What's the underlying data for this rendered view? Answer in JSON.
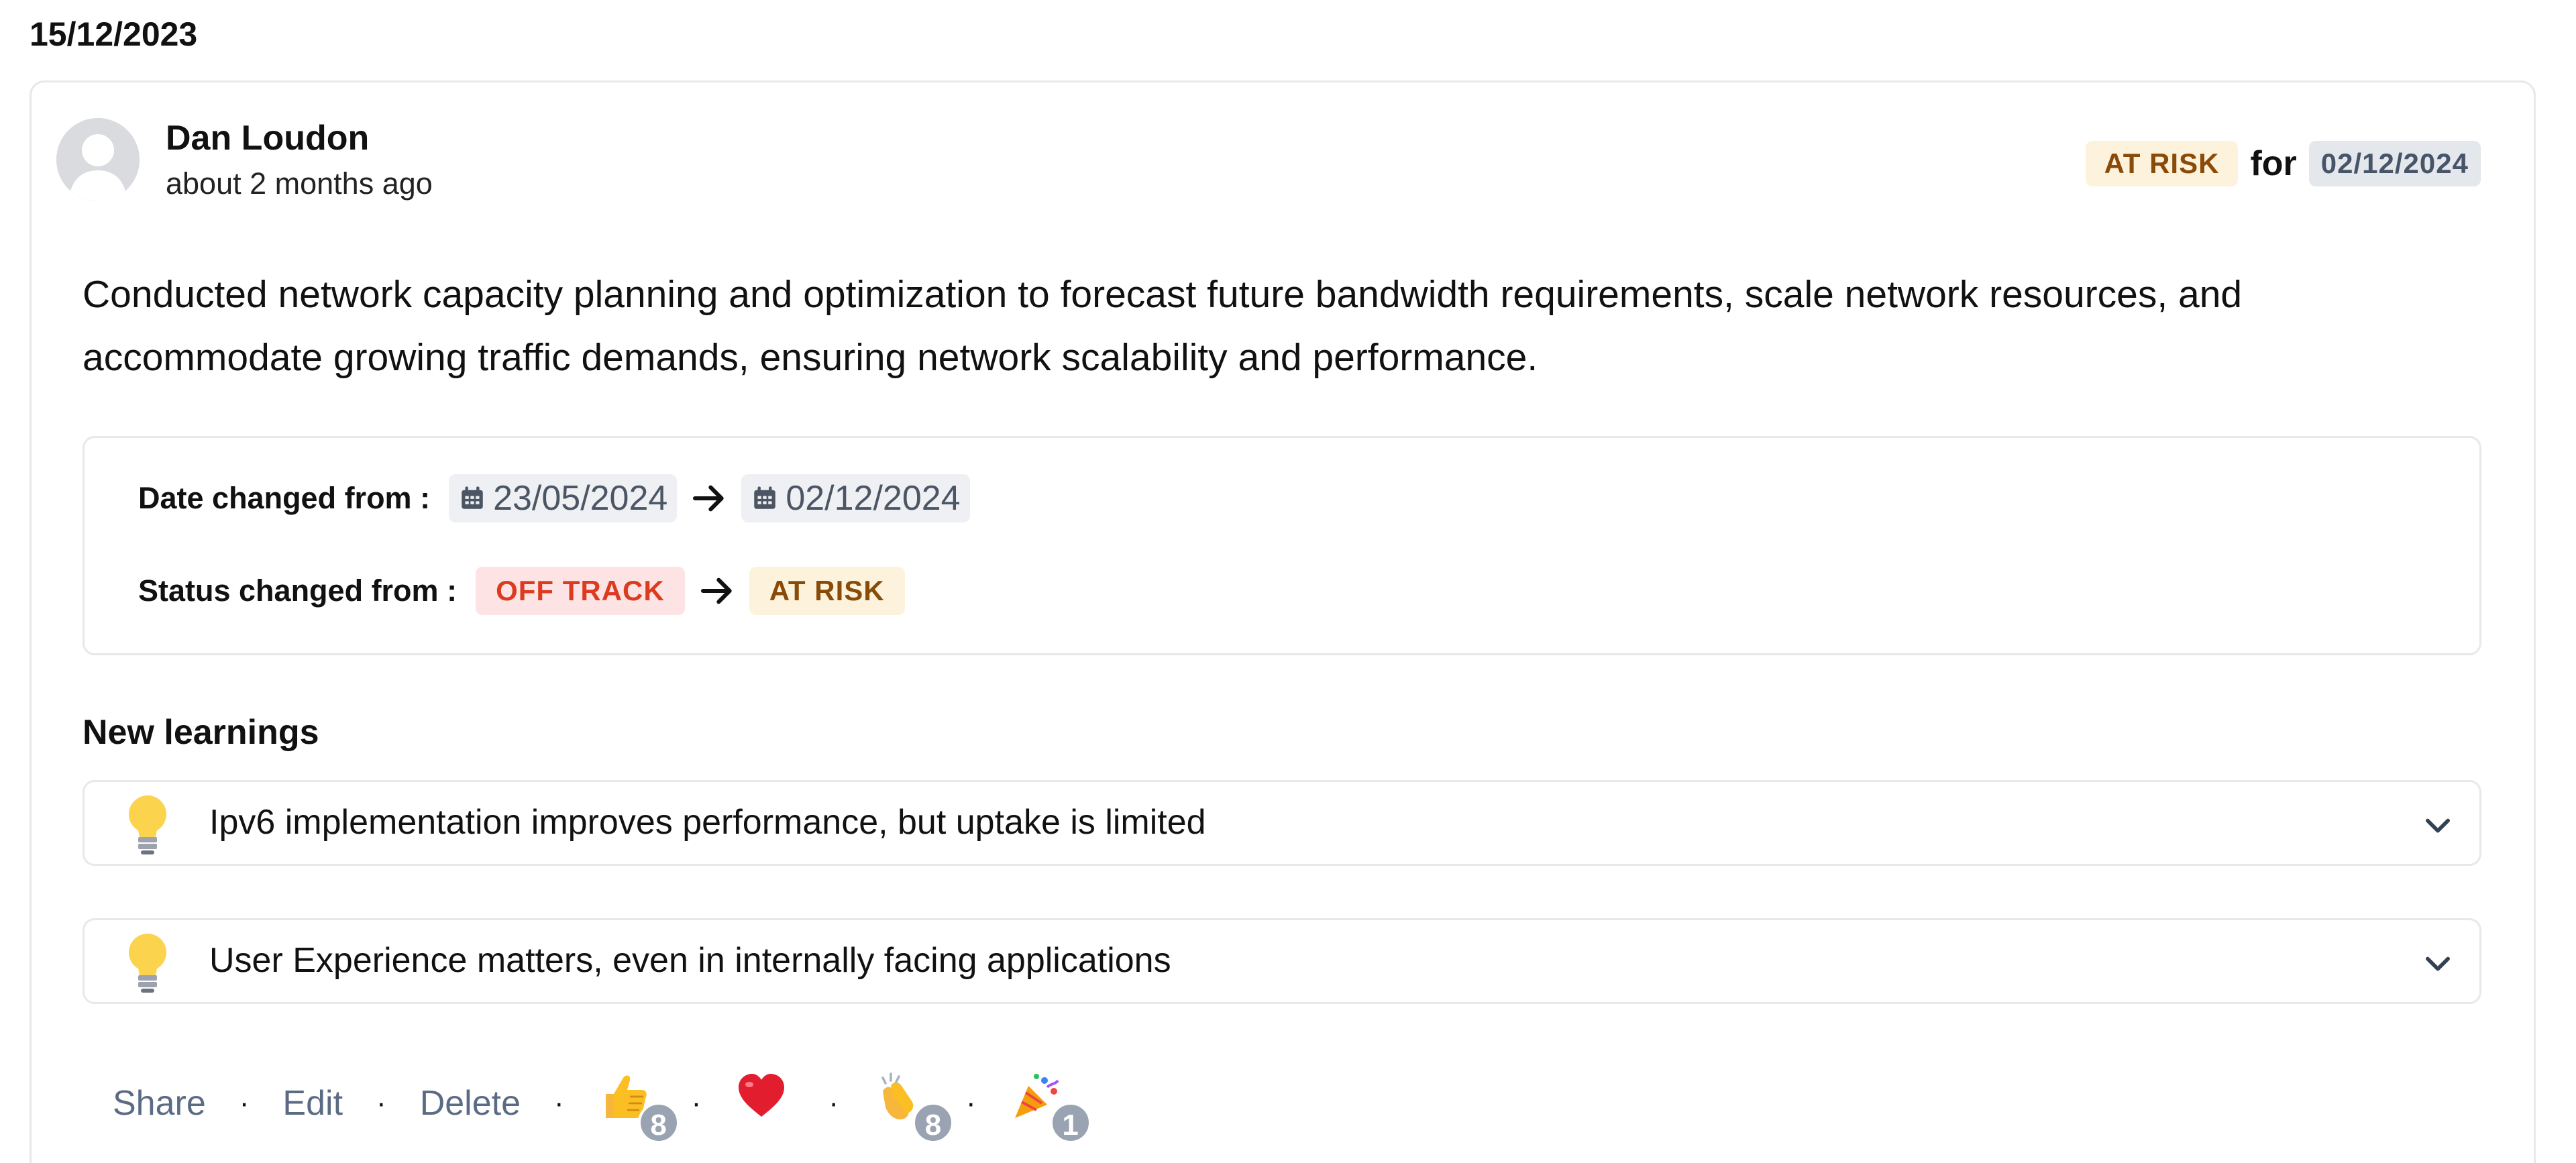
{
  "date_heading": "15/12/2023",
  "post": {
    "author": "Dan Loudon",
    "time_ago": "about 2 months ago",
    "status_label": "AT RISK",
    "for_text": "for",
    "target_date": "02/12/2024",
    "description": "Conducted network capacity planning and optimization to forecast future bandwidth requirements, scale network resources, and accommodate growing traffic demands, ensuring network scalability and performance."
  },
  "changes": {
    "date_label": "Date changed from :",
    "date_from": "23/05/2024",
    "date_to": "02/12/2024",
    "status_label": "Status changed from :",
    "status_from": "OFF TRACK",
    "status_to": "AT RISK"
  },
  "learnings": {
    "title": "New learnings",
    "items": [
      {
        "icon": "lightbulb-icon",
        "text": "Ipv6 implementation improves performance, but uptake is limited"
      },
      {
        "icon": "lightbulb-icon",
        "text": "User Experience matters, even in internally facing applications"
      }
    ]
  },
  "actions": {
    "share": "Share",
    "edit": "Edit",
    "delete": "Delete",
    "separator": "·"
  },
  "reactions": [
    {
      "icon": "thumbs-up-icon",
      "count": "8"
    },
    {
      "icon": "heart-icon",
      "count": ""
    },
    {
      "icon": "clapping-hands-icon",
      "count": "8"
    },
    {
      "icon": "party-popper-icon",
      "count": "1"
    }
  ],
  "colors": {
    "at_risk_bg": "#fdf3dc",
    "at_risk_text": "#8a4a08",
    "off_track_bg": "#fde3e3",
    "off_track_text": "#dc3b1f",
    "date_pill_bg": "#e4e7ec",
    "action_text": "#5b6b84"
  }
}
